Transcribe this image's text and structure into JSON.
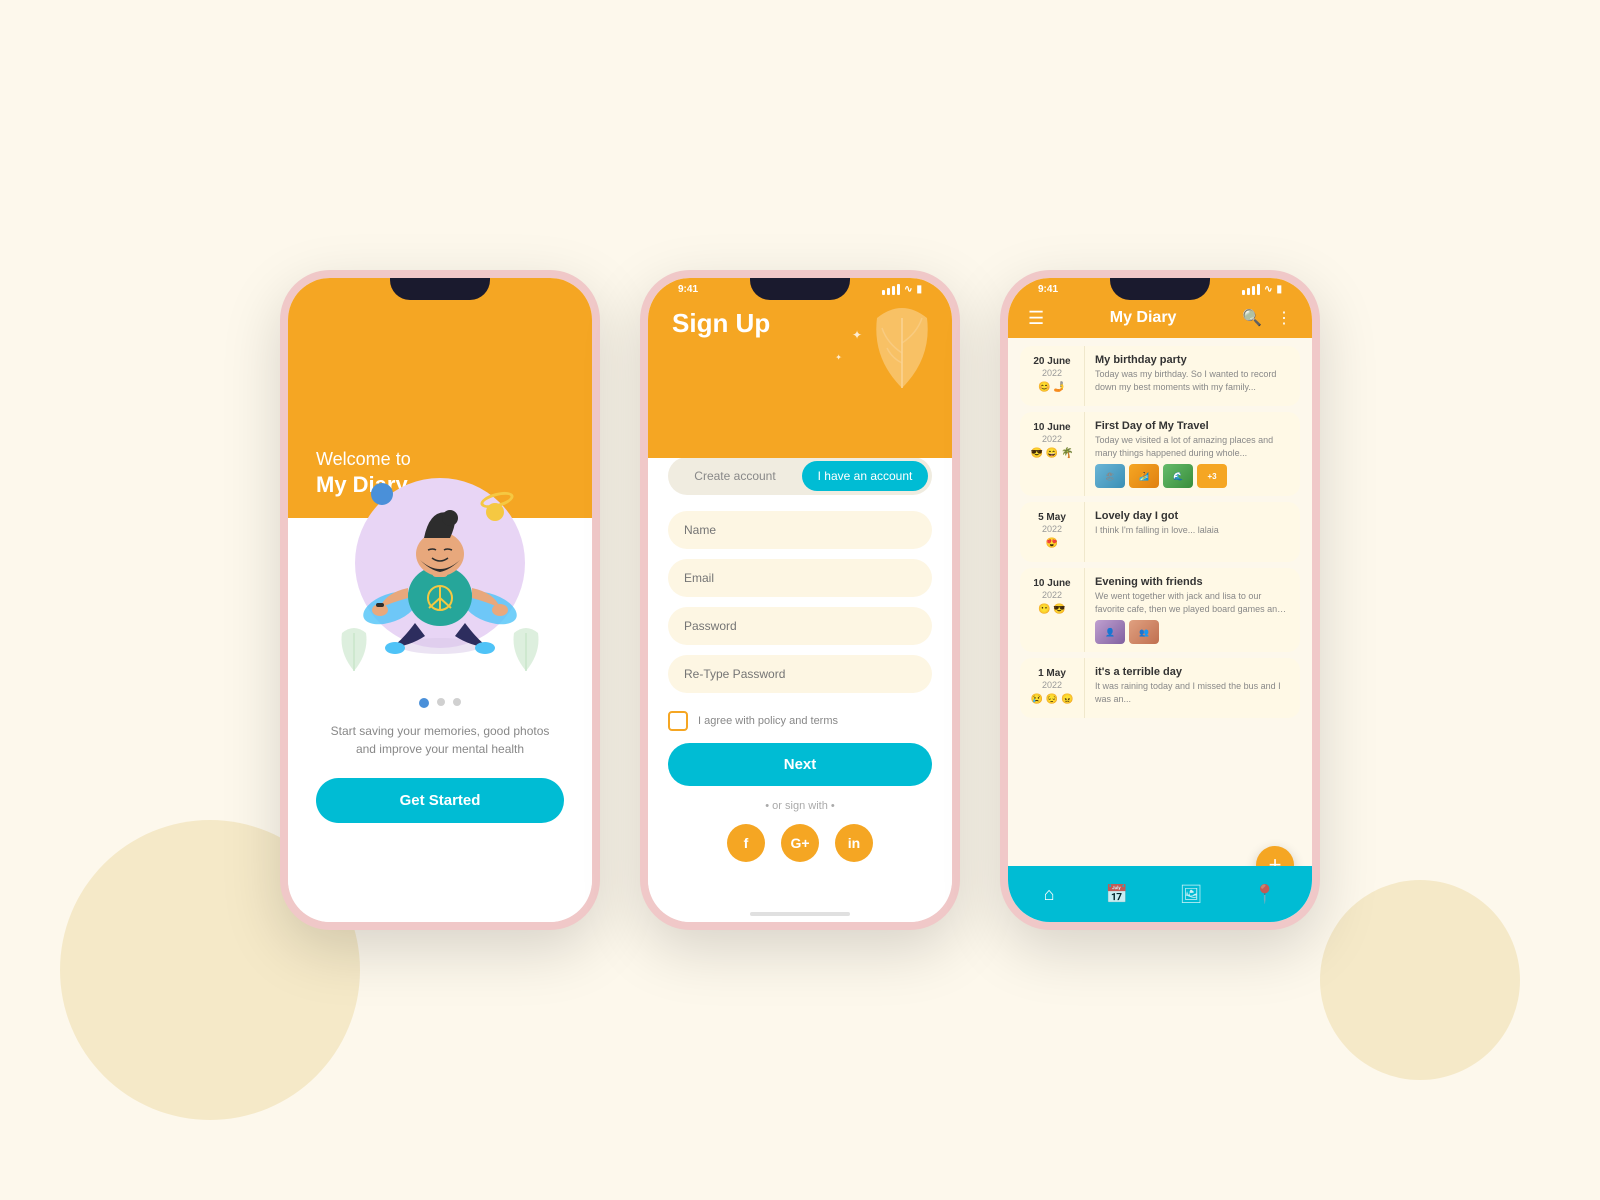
{
  "background": "#fdf8ec",
  "phones": {
    "phone1": {
      "welcome_line1": "Welcome to",
      "welcome_line2": "My Diary",
      "tagline": "Start saving your memories, good photos\nand improve your mental health",
      "get_started": "Get Started",
      "dots": [
        true,
        false,
        false
      ]
    },
    "phone2": {
      "status_time": "9:41",
      "header_title": "Sign Up",
      "tab_create": "Create account",
      "tab_login": "I have an account",
      "fields": {
        "name": "Name",
        "email": "Email",
        "password": "Password",
        "retype": "Re-Type Password"
      },
      "checkbox_label": "I agree with policy and terms",
      "next_btn": "Next",
      "or_sign": "• or sign with •",
      "social_btns": [
        "f",
        "G+",
        "in"
      ]
    },
    "phone3": {
      "status_time": "9:41",
      "app_title": "My Diary",
      "entries": [
        {
          "day_month": "20 June",
          "year": "2022",
          "emojis": "😊 🤳",
          "title": "My birthday party",
          "text": "Today was my birthday. So I wanted to record down my best moments with my family...",
          "images": []
        },
        {
          "day_month": "10 June",
          "year": "2022",
          "emojis": "😎 😄 🌴",
          "title": "First Day of My Travel",
          "text": "Today we visited a lot of amazing places and many things happened during whole...",
          "images": [
            "blue",
            "orange",
            "green",
            "+3"
          ]
        },
        {
          "day_month": "5 May",
          "year": "2022",
          "emojis": "😍",
          "title": "Lovely day I got",
          "text": "I think I'm falling in love... lalaia",
          "images": []
        },
        {
          "day_month": "10 June",
          "year": "2022",
          "emojis": "😶 😎",
          "title": "Evening with friends",
          "text": "We went together with jack and lisa to our favorite cafe, then we played board games and jake...",
          "images": [
            "purple",
            "warm"
          ]
        },
        {
          "day_month": "1 May",
          "year": "2022",
          "emojis": "😢 😔 😠",
          "title": "it's a terrible day",
          "text": "It was raining today and I missed the bus and I was an...",
          "images": []
        }
      ],
      "nav_icons": [
        "home",
        "calendar",
        "gallery",
        "location"
      ]
    }
  }
}
